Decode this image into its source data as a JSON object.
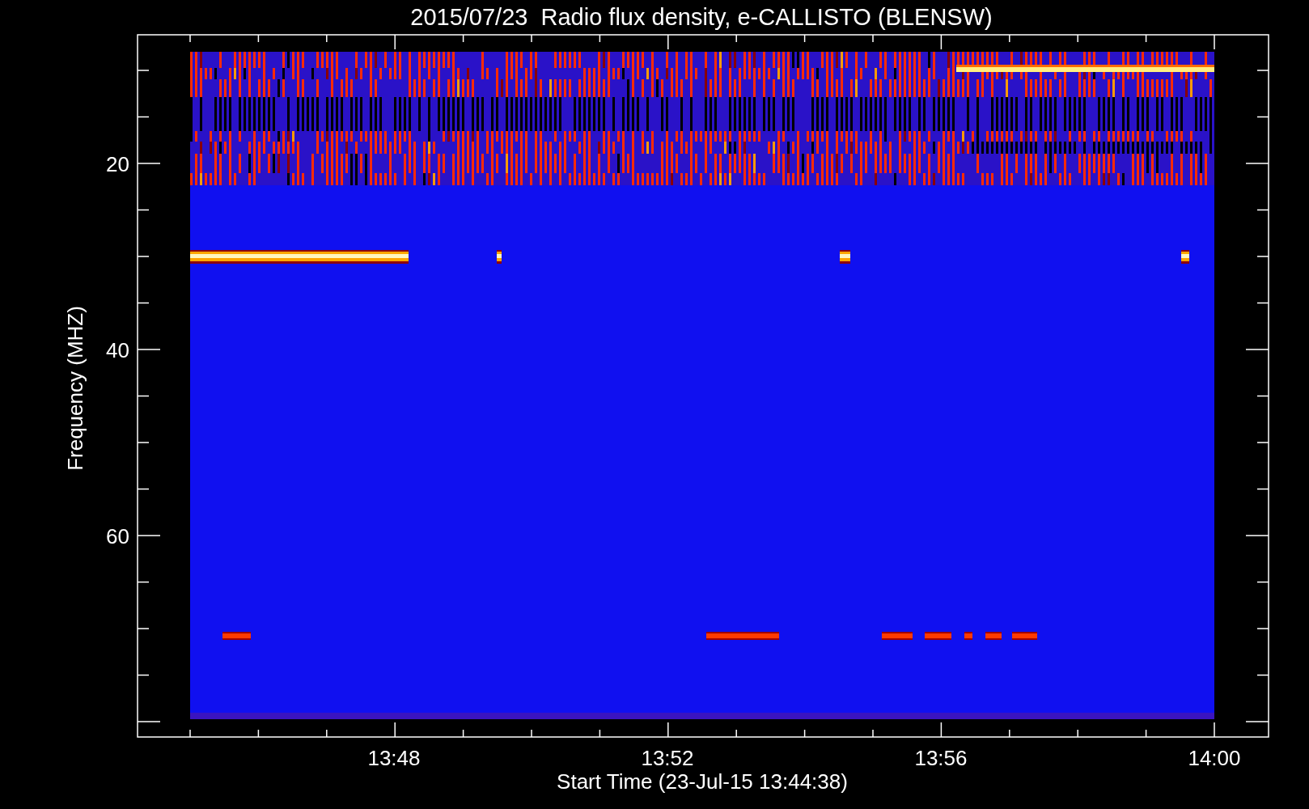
{
  "title": "2015/07/23  Radio flux density, e-CALLISTO (BLENSW)",
  "x_axis": {
    "label": "Start Time (23-Jul-15 13:44:38)",
    "ticks": [
      "13:48",
      "13:52",
      "13:56",
      "14:00"
    ]
  },
  "y_axis": {
    "label": "Frequency (MHZ)",
    "ticks": [
      "20",
      "40",
      "60"
    ]
  }
}
